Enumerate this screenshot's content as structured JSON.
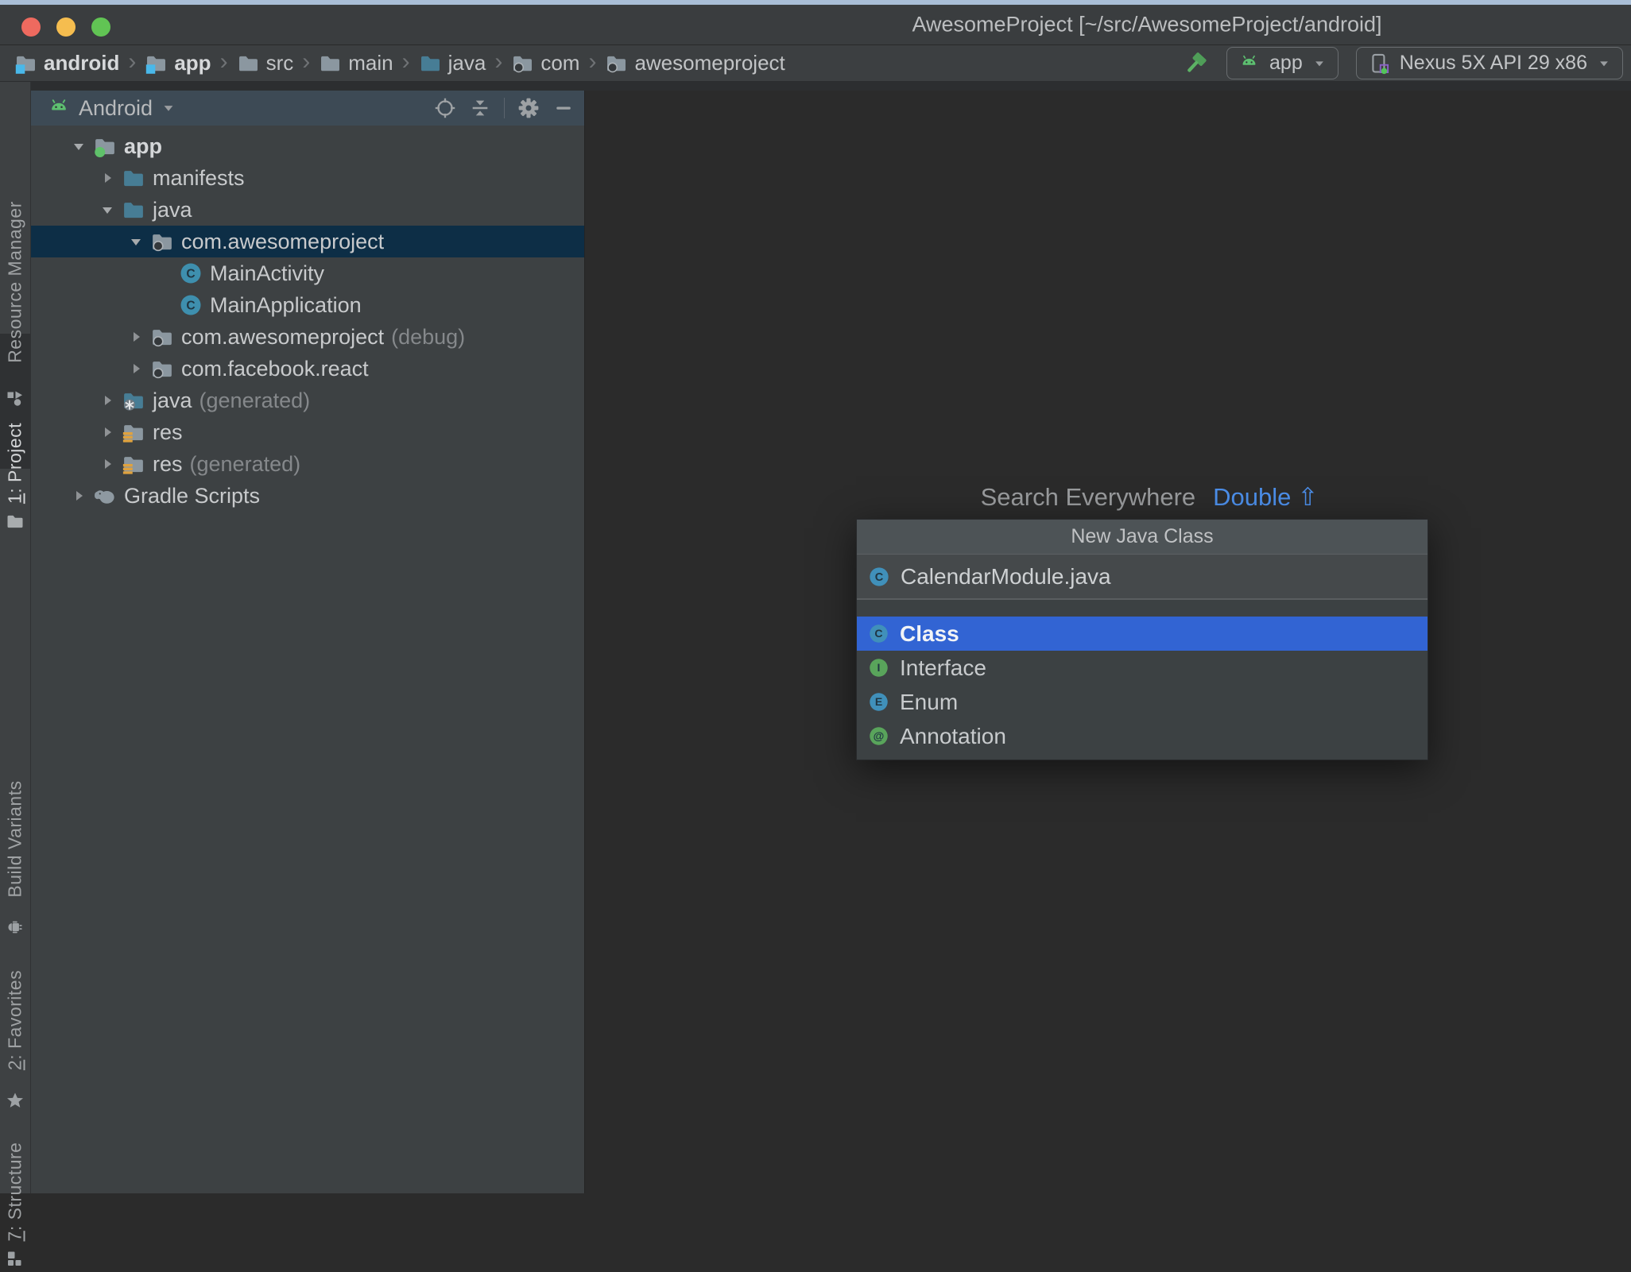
{
  "colors": {
    "selection_blue": "#3264d3",
    "tree_selection_navy": "#0d2e46",
    "hint_blue": "#4c8fea",
    "android_green": "#5dbf70",
    "hammer_green": "#55a15c",
    "res_orange": "#e0a23e",
    "module_badge_blue": "#49b8ea",
    "traffic_red": "#ee6a5f",
    "traffic_yellow": "#f5bd4f",
    "traffic_green": "#61c454"
  },
  "window": {
    "title": "AwesomeProject [~/src/AwesomeProject/android]"
  },
  "breadcrumb_bar": {
    "separator": "›",
    "items": [
      {
        "label": "android",
        "icon": "module-folder-icon",
        "bold": true
      },
      {
        "label": "app",
        "icon": "module-folder-icon",
        "bold": true
      },
      {
        "label": "src",
        "icon": "folder-icon",
        "bold": false
      },
      {
        "label": "main",
        "icon": "folder-icon",
        "bold": false
      },
      {
        "label": "java",
        "icon": "source-folder-icon",
        "bold": false
      },
      {
        "label": "com",
        "icon": "package-folder-icon",
        "bold": false
      },
      {
        "label": "awesomeproject",
        "icon": "package-folder-icon",
        "bold": false
      }
    ],
    "run_configuration": {
      "label": "app"
    },
    "device_selector": {
      "label": "Nexus 5X API 29 x86"
    }
  },
  "tool_stripe": {
    "resource_manager": {
      "mnemonic": "",
      "rest": "Resource Manager"
    },
    "project": {
      "mnemonic": "1",
      "rest": ": Project"
    },
    "build_variants": {
      "mnemonic": "",
      "rest": "Build Variants"
    },
    "favorites": {
      "mnemonic": "2",
      "rest": ": Favorites"
    },
    "structure": {
      "mnemonic": "7",
      "rest": ": Structure"
    }
  },
  "project_panel": {
    "view_selector": "Android",
    "tree": [
      {
        "level": 0,
        "arrow": "expanded",
        "icon": "app-module-folder",
        "label": "app",
        "bold": true,
        "selected": false,
        "suffix": ""
      },
      {
        "level": 1,
        "arrow": "collapsed",
        "icon": "source-set-folder",
        "label": "manifests",
        "bold": false,
        "selected": false,
        "suffix": ""
      },
      {
        "level": 1,
        "arrow": "expanded",
        "icon": "source-set-folder",
        "label": "java",
        "bold": false,
        "selected": false,
        "suffix": ""
      },
      {
        "level": 2,
        "arrow": "expanded",
        "icon": "package-folder",
        "label": "com.awesomeproject",
        "bold": false,
        "selected": true,
        "suffix": ""
      },
      {
        "level": 3,
        "arrow": "none",
        "icon": "class",
        "label": "MainActivity",
        "bold": false,
        "selected": false,
        "suffix": ""
      },
      {
        "level": 3,
        "arrow": "none",
        "icon": "class",
        "label": "MainApplication",
        "bold": false,
        "selected": false,
        "suffix": ""
      },
      {
        "level": 2,
        "arrow": "collapsed",
        "icon": "package-folder",
        "label": "com.awesomeproject",
        "bold": false,
        "selected": false,
        "suffix": "(debug)"
      },
      {
        "level": 2,
        "arrow": "collapsed",
        "icon": "package-folder",
        "label": "com.facebook.react",
        "bold": false,
        "selected": false,
        "suffix": ""
      },
      {
        "level": 1,
        "arrow": "collapsed",
        "icon": "generated-java-folder",
        "label": "java",
        "bold": false,
        "selected": false,
        "suffix": "(generated)"
      },
      {
        "level": 1,
        "arrow": "collapsed",
        "icon": "res-folder",
        "label": "res",
        "bold": false,
        "selected": false,
        "suffix": ""
      },
      {
        "level": 1,
        "arrow": "collapsed",
        "icon": "res-folder",
        "label": "res",
        "bold": false,
        "selected": false,
        "suffix": "(generated)"
      },
      {
        "level": 0,
        "arrow": "collapsed",
        "icon": "gradle",
        "label": "Gradle Scripts",
        "bold": false,
        "selected": false,
        "suffix": ""
      }
    ]
  },
  "editor": {
    "hint_text": "Search Everywhere",
    "hint_shortcut": "Double",
    "hint_shortcut_symbol": "⇧"
  },
  "popup": {
    "title": "New Java Class",
    "file_name": "CalendarModule.java",
    "options": [
      {
        "label": "Class",
        "icon_letter": "C",
        "icon_color": "#4090ba",
        "selected": true
      },
      {
        "label": "Interface",
        "icon_letter": "I",
        "icon_color": "#59a45b",
        "selected": false
      },
      {
        "label": "Enum",
        "icon_letter": "E",
        "icon_color": "#4090ba",
        "selected": false
      },
      {
        "label": "Annotation",
        "icon_letter": "@",
        "icon_color": "#59a45b",
        "selected": false
      }
    ]
  }
}
